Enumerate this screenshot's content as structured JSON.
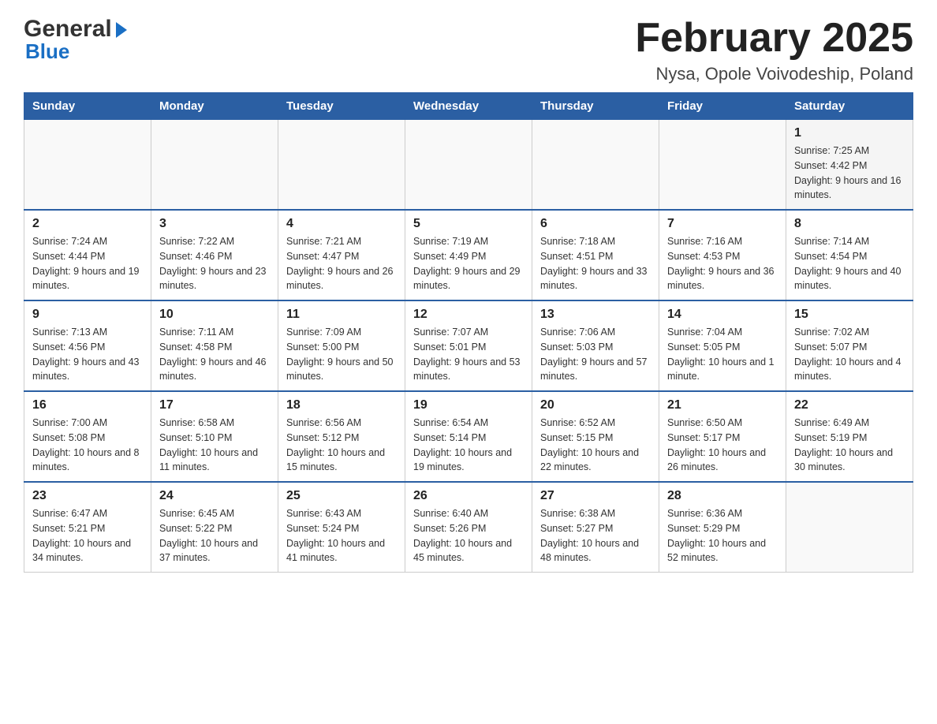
{
  "header": {
    "logo_general": "General",
    "logo_arrow": "▶",
    "logo_blue": "Blue",
    "month_title": "February 2025",
    "location": "Nysa, Opole Voivodeship, Poland"
  },
  "weekdays": [
    "Sunday",
    "Monday",
    "Tuesday",
    "Wednesday",
    "Thursday",
    "Friday",
    "Saturday"
  ],
  "weeks": [
    {
      "days": [
        {
          "number": "",
          "info": ""
        },
        {
          "number": "",
          "info": ""
        },
        {
          "number": "",
          "info": ""
        },
        {
          "number": "",
          "info": ""
        },
        {
          "number": "",
          "info": ""
        },
        {
          "number": "",
          "info": ""
        },
        {
          "number": "1",
          "info": "Sunrise: 7:25 AM\nSunset: 4:42 PM\nDaylight: 9 hours and 16 minutes."
        }
      ]
    },
    {
      "days": [
        {
          "number": "2",
          "info": "Sunrise: 7:24 AM\nSunset: 4:44 PM\nDaylight: 9 hours and 19 minutes."
        },
        {
          "number": "3",
          "info": "Sunrise: 7:22 AM\nSunset: 4:46 PM\nDaylight: 9 hours and 23 minutes."
        },
        {
          "number": "4",
          "info": "Sunrise: 7:21 AM\nSunset: 4:47 PM\nDaylight: 9 hours and 26 minutes."
        },
        {
          "number": "5",
          "info": "Sunrise: 7:19 AM\nSunset: 4:49 PM\nDaylight: 9 hours and 29 minutes."
        },
        {
          "number": "6",
          "info": "Sunrise: 7:18 AM\nSunset: 4:51 PM\nDaylight: 9 hours and 33 minutes."
        },
        {
          "number": "7",
          "info": "Sunrise: 7:16 AM\nSunset: 4:53 PM\nDaylight: 9 hours and 36 minutes."
        },
        {
          "number": "8",
          "info": "Sunrise: 7:14 AM\nSunset: 4:54 PM\nDaylight: 9 hours and 40 minutes."
        }
      ]
    },
    {
      "days": [
        {
          "number": "9",
          "info": "Sunrise: 7:13 AM\nSunset: 4:56 PM\nDaylight: 9 hours and 43 minutes."
        },
        {
          "number": "10",
          "info": "Sunrise: 7:11 AM\nSunset: 4:58 PM\nDaylight: 9 hours and 46 minutes."
        },
        {
          "number": "11",
          "info": "Sunrise: 7:09 AM\nSunset: 5:00 PM\nDaylight: 9 hours and 50 minutes."
        },
        {
          "number": "12",
          "info": "Sunrise: 7:07 AM\nSunset: 5:01 PM\nDaylight: 9 hours and 53 minutes."
        },
        {
          "number": "13",
          "info": "Sunrise: 7:06 AM\nSunset: 5:03 PM\nDaylight: 9 hours and 57 minutes."
        },
        {
          "number": "14",
          "info": "Sunrise: 7:04 AM\nSunset: 5:05 PM\nDaylight: 10 hours and 1 minute."
        },
        {
          "number": "15",
          "info": "Sunrise: 7:02 AM\nSunset: 5:07 PM\nDaylight: 10 hours and 4 minutes."
        }
      ]
    },
    {
      "days": [
        {
          "number": "16",
          "info": "Sunrise: 7:00 AM\nSunset: 5:08 PM\nDaylight: 10 hours and 8 minutes."
        },
        {
          "number": "17",
          "info": "Sunrise: 6:58 AM\nSunset: 5:10 PM\nDaylight: 10 hours and 11 minutes."
        },
        {
          "number": "18",
          "info": "Sunrise: 6:56 AM\nSunset: 5:12 PM\nDaylight: 10 hours and 15 minutes."
        },
        {
          "number": "19",
          "info": "Sunrise: 6:54 AM\nSunset: 5:14 PM\nDaylight: 10 hours and 19 minutes."
        },
        {
          "number": "20",
          "info": "Sunrise: 6:52 AM\nSunset: 5:15 PM\nDaylight: 10 hours and 22 minutes."
        },
        {
          "number": "21",
          "info": "Sunrise: 6:50 AM\nSunset: 5:17 PM\nDaylight: 10 hours and 26 minutes."
        },
        {
          "number": "22",
          "info": "Sunrise: 6:49 AM\nSunset: 5:19 PM\nDaylight: 10 hours and 30 minutes."
        }
      ]
    },
    {
      "days": [
        {
          "number": "23",
          "info": "Sunrise: 6:47 AM\nSunset: 5:21 PM\nDaylight: 10 hours and 34 minutes."
        },
        {
          "number": "24",
          "info": "Sunrise: 6:45 AM\nSunset: 5:22 PM\nDaylight: 10 hours and 37 minutes."
        },
        {
          "number": "25",
          "info": "Sunrise: 6:43 AM\nSunset: 5:24 PM\nDaylight: 10 hours and 41 minutes."
        },
        {
          "number": "26",
          "info": "Sunrise: 6:40 AM\nSunset: 5:26 PM\nDaylight: 10 hours and 45 minutes."
        },
        {
          "number": "27",
          "info": "Sunrise: 6:38 AM\nSunset: 5:27 PM\nDaylight: 10 hours and 48 minutes."
        },
        {
          "number": "28",
          "info": "Sunrise: 6:36 AM\nSunset: 5:29 PM\nDaylight: 10 hours and 52 minutes."
        },
        {
          "number": "",
          "info": ""
        }
      ]
    }
  ]
}
